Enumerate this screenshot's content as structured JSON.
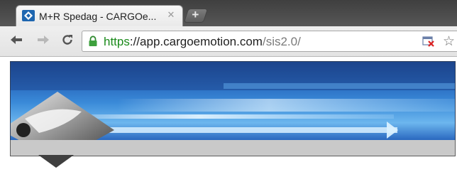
{
  "browser": {
    "tab": {
      "title": "M+R Spedag - CARGOe...",
      "close_label": "✕"
    },
    "new_tab_label": "+",
    "address": {
      "scheme": "https",
      "separator": "://",
      "host": "app.cargoemotion.com",
      "path": "/sis2.0/"
    },
    "icons": {
      "back": "back-arrow-icon",
      "forward": "forward-arrow-icon",
      "reload": "reload-icon",
      "lock": "lock-icon",
      "page_action": "blocked-content-icon",
      "bookmark": "star-icon"
    },
    "colors": {
      "scheme_green": "#1a8a1a",
      "banner_blue": "#2e73c6"
    }
  }
}
